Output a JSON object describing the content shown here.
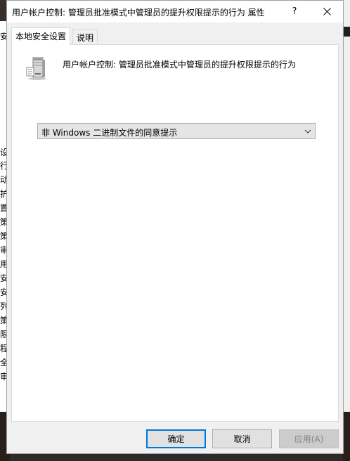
{
  "dialog": {
    "title": "用户帐户控制: 管理员批准模式中管理员的提升权限提示的行为 属性",
    "help_label": "?",
    "tabs": [
      {
        "label": "本地安全设置",
        "active": true
      },
      {
        "label": "说明",
        "active": false
      }
    ],
    "policy_name": "用户帐户控制: 管理员批准模式中管理员的提升权限提示的行为",
    "dropdown": {
      "selected": "非 Windows 二进制文件的同意提示"
    },
    "buttons": {
      "ok": "确定",
      "cancel": "取消",
      "apply": "应用(A)"
    }
  },
  "background": {
    "left_fragments": [
      "安",
      "设",
      "行",
      "动",
      "护",
      "置",
      "策",
      "策",
      "审",
      "用",
      "安",
      "安",
      "列",
      "策",
      "限",
      "程",
      "全",
      "审"
    ]
  }
}
